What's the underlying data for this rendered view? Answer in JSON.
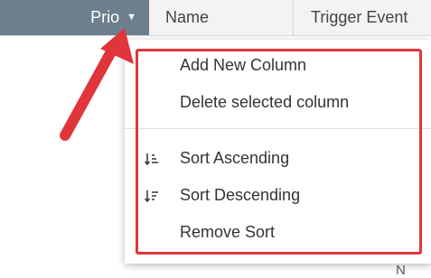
{
  "table": {
    "columns": [
      {
        "label": "Prio",
        "caret": "▼"
      },
      {
        "label": "Name"
      },
      {
        "label": "Trigger Event"
      }
    ]
  },
  "context_menu": {
    "items": [
      {
        "label": "Add New Column",
        "icon": null
      },
      {
        "label": "Delete selected column",
        "icon": null
      },
      {
        "label": "Sort Ascending",
        "icon": "sort-ascending-icon"
      },
      {
        "label": "Sort Descending",
        "icon": "sort-descending-icon"
      },
      {
        "label": "Remove Sort",
        "icon": null
      }
    ]
  },
  "below_menu_text": "N",
  "colors": {
    "header_active_bg": "#6d7f8c",
    "highlight_border": "#e0353b",
    "arrow": "#e0353b"
  }
}
